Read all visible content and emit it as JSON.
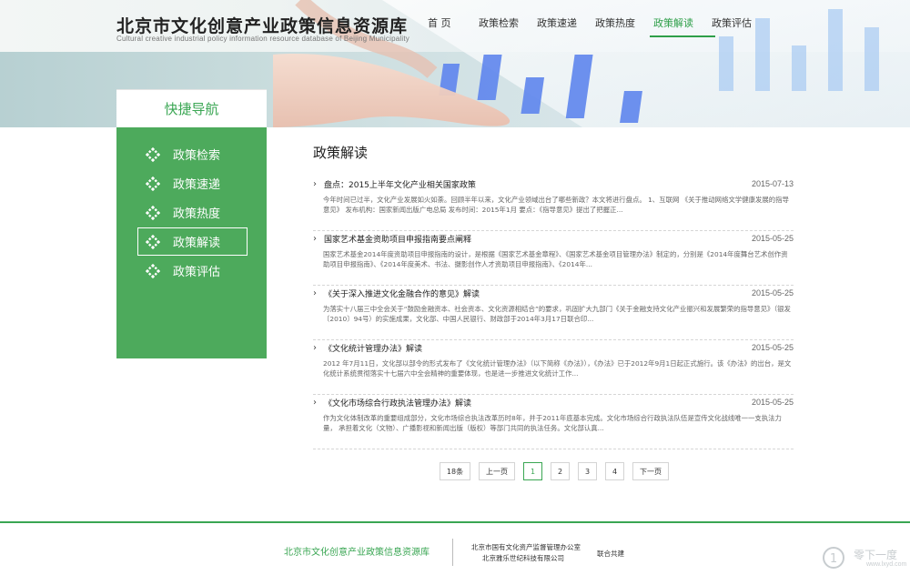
{
  "header": {
    "title": "北京市文化创意产业政策信息资源库",
    "subtitle": "Cultural creative industrial policy information resource database of Beijing Municipality"
  },
  "nav": {
    "items": [
      {
        "label": "首 页",
        "active": false
      },
      {
        "label": "政策检索",
        "active": false
      },
      {
        "label": "政策速递",
        "active": false
      },
      {
        "label": "政策热度",
        "active": false
      },
      {
        "label": "政策解读",
        "active": true
      },
      {
        "label": "政策评估",
        "active": false
      }
    ]
  },
  "sidebar": {
    "header": "快捷导航",
    "items": [
      {
        "label": "政策检索",
        "active": false
      },
      {
        "label": "政策速递",
        "active": false
      },
      {
        "label": "政策热度",
        "active": false
      },
      {
        "label": "政策解读",
        "active": true
      },
      {
        "label": "政策评估",
        "active": false
      }
    ]
  },
  "content": {
    "title": "政策解读",
    "articles": [
      {
        "title": "盘点：2015上半年文化产业相关国家政策",
        "date": "2015-07-13",
        "summary": "今年时间已过半，文化产业发展如火如荼。回顾半年以来，文化产业领域出台了哪些新政？本文将进行盘点。 1、互联网 《关于推动网络文学健康发展的指导意见》 发布机构：国家新闻出版广电总局 发布时间：2015年1月 要点：《指导意见》提出了把握正..."
      },
      {
        "title": "国家艺术基金资助项目申报指南要点阐释",
        "date": "2015-05-25",
        "summary": "国家艺术基金2014年度资助项目申报指南的设计，是根据《国家艺术基金章程》、《国家艺术基金项目管理办法》制定的，分别是《2014年度舞台艺术创作资助项目申报指南》、《2014年度美术、书法、摄影创作人才资助项目申报指南》、《2014年..."
      },
      {
        "title": "《关于深入推进文化金融合作的意见》解读",
        "date": "2015-05-25",
        "summary": "为落实十八届三中全会关于“鼓励金融资本、社会资本、文化资源相结合”的要求，巩固扩大九部门《关于金融支持文化产业振兴和发展繁荣的指导意见》（银发〔2010〕94号）的实施成果，文化部、中国人民银行、财政部于2014年3月17日联合印..."
      },
      {
        "title": "《文化统计管理办法》解读",
        "date": "2015-05-25",
        "summary": "2012 年7月11日，文化部以部令的形式发布了《文化统计管理办法》（以下简称《办法》），《办法》已于2012年9月1日起正式施行。该《办法》的出台，是文 化统计系统贯彻落实十七届六中全会精神的重要体现，也是进一步推进文化统计工作..."
      },
      {
        "title": "《文化市场综合行政执法管理办法》解读",
        "date": "2015-05-25",
        "summary": "作为文化体制改革的重要组成部分，文化市场综合执法改革历时8年，并于2011年底基本完成。文化市场综合行政执法队伍是宣传文化战线唯一一支执法力量， 承担着文化（文物）、广播影视和新闻出版（版权）等部门共同的执法任务。文化部认真..."
      }
    ]
  },
  "pager": {
    "total": "18条",
    "prev": "上一页",
    "pages": [
      "1",
      "2",
      "3",
      "4"
    ],
    "current": "1",
    "next": "下一页"
  },
  "footer": {
    "site_name": "北京市文化创意产业政策信息资源库",
    "org1": "北京市国有文化资产监督管理办公室",
    "org2": "北京雅乐世纪科技有限公司",
    "joint": "联合共建"
  },
  "watermark": {
    "text": "零下一度",
    "url": "www.lxyd.com"
  },
  "colors": {
    "accent": "#3aa653",
    "sidebar_bg": "#4daa5c",
    "chart_bar": "#6b8df0"
  }
}
